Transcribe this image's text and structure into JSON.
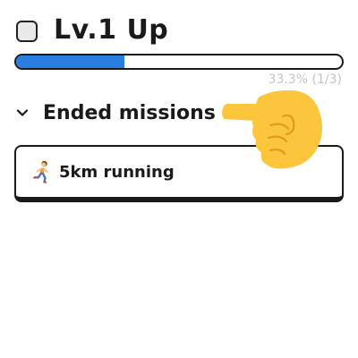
{
  "level": {
    "checked": false,
    "title": "Lv.1 Up"
  },
  "progress": {
    "fraction": 0.333,
    "label": "33.3% (1/3)",
    "fill_color": "#2a7de1"
  },
  "section": {
    "title": "Ended missions",
    "expanded": true,
    "icon": "chevron-down-icon"
  },
  "missions": [
    {
      "icon": "runner-icon",
      "label": "5km running"
    }
  ],
  "overlay": {
    "icon": "pointing-hand-icon",
    "color": "#fbc63c"
  }
}
